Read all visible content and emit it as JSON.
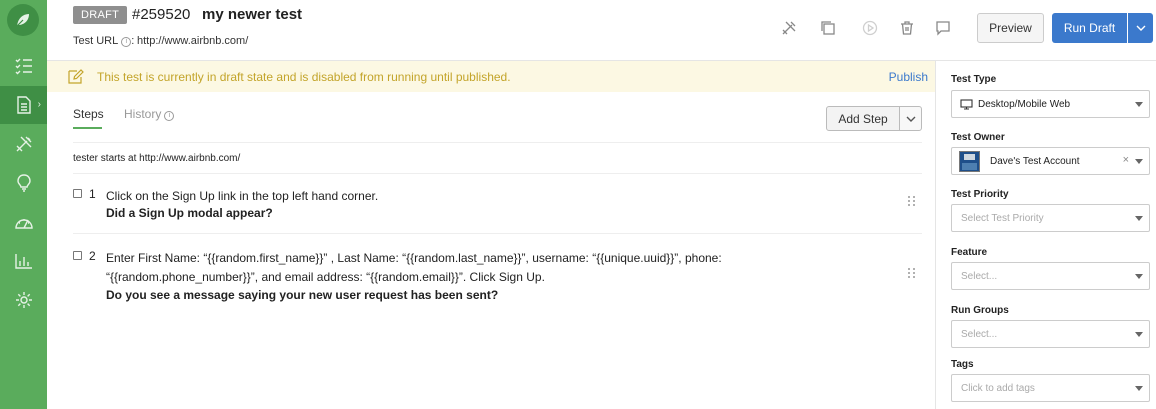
{
  "header": {
    "badge": "DRAFT",
    "test_id": "#259520",
    "test_name": "my newer test",
    "url_label": "Test URL",
    "url_value": "http://www.airbnb.com/",
    "preview_label": "Preview",
    "run_label": "Run Draft"
  },
  "banner": {
    "message": "This test is currently in draft state and is disabled from running until published.",
    "publish_label": "Publish",
    "color": "#c3a42a",
    "background": "#fcf8e3"
  },
  "tabs": {
    "steps_label": "Steps",
    "history_label": "History"
  },
  "add_step_label": "Add Step",
  "start_text": "tester starts at http://www.airbnb.com/",
  "steps": [
    {
      "number": "1",
      "action": "Click on the Sign Up link in the top left hand corner.",
      "expected": "Did a Sign Up modal appear?"
    },
    {
      "number": "2",
      "action": "Enter First Name: “{{random.first_name}}” , Last Name: “{{random.last_name}}”, username: “{{unique.uuid}}”, phone: “{{random.phone_number}}”, and email address: “{{random.email}}”. Click Sign Up.",
      "expected": "Do you see a message saying your new user request has been sent?"
    }
  ],
  "panel": {
    "test_type": {
      "label": "Test Type",
      "value": "Desktop/Mobile Web"
    },
    "test_owner": {
      "label": "Test Owner",
      "value": "Dave's Test Account"
    },
    "test_priority": {
      "label": "Test Priority",
      "placeholder": "Select Test Priority"
    },
    "feature": {
      "label": "Feature",
      "placeholder": "Select..."
    },
    "run_groups": {
      "label": "Run Groups",
      "placeholder": "Select..."
    },
    "tags": {
      "label": "Tags",
      "placeholder": "Click to add tags"
    }
  },
  "colors": {
    "sidebar": "#5aac5c",
    "sidebar_active": "#3f8f45",
    "primary": "#3b79cc",
    "badge": "#8f8f8f"
  },
  "icons": {
    "sidebar": [
      "logo-leaf-icon",
      "checklist-icon",
      "document-icon",
      "tools-icon",
      "lightbulb-icon",
      "dashboard-icon",
      "bar-chart-icon",
      "gear-icon"
    ],
    "toolbar": [
      "tools-icon",
      "duplicate-icon",
      "play-icon",
      "trash-icon",
      "comment-icon"
    ]
  }
}
